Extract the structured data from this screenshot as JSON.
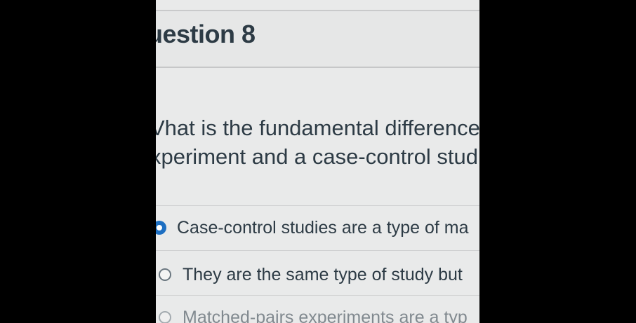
{
  "quiz": {
    "question_title": "uestion 8",
    "question_text_line1": "Vhat is the fundamental difference",
    "question_text_line2": "xperiment and a case-control stud",
    "answers": [
      {
        "label": "Case-control studies are a type of ma",
        "selected": true
      },
      {
        "label": "They are the same type of study but",
        "selected": false
      },
      {
        "label": "Matched-pairs experiments are a typ",
        "selected": false
      }
    ]
  },
  "colors": {
    "background": "#000000",
    "page": "#e9eaea",
    "text": "#2d3b45",
    "accent": "#1d6fc2"
  }
}
